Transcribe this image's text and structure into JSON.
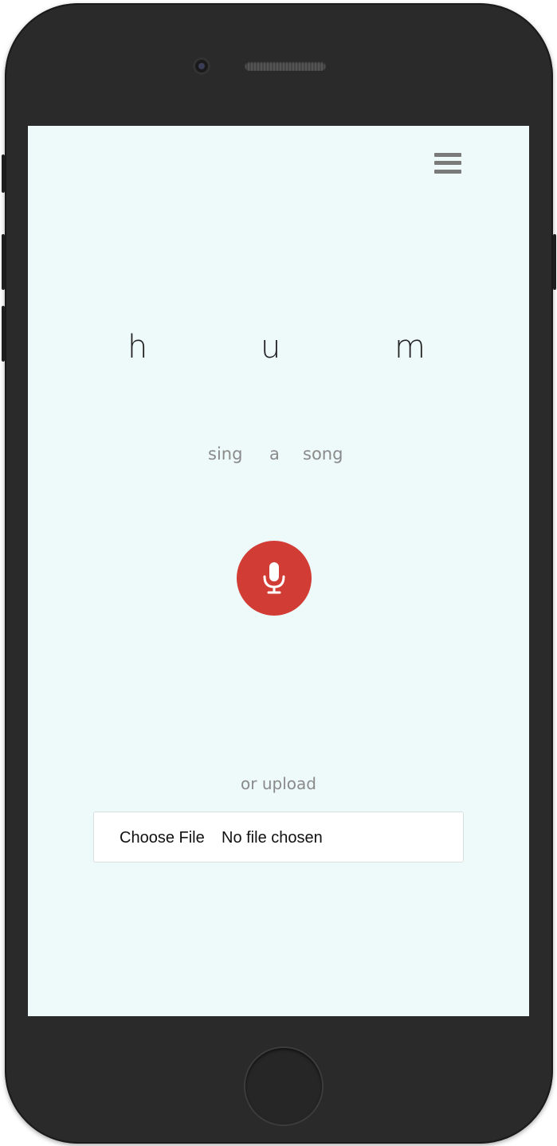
{
  "header": {
    "menu_icon": "hamburger-menu-icon"
  },
  "brand": {
    "letters": [
      "h",
      "u",
      "m"
    ]
  },
  "tagline": {
    "words": [
      "sing",
      "a",
      "song"
    ]
  },
  "record": {
    "icon": "microphone-icon",
    "color": "#d13c34"
  },
  "upload": {
    "label": "or upload",
    "button_label": "Choose File",
    "status": "No file chosen"
  },
  "colors": {
    "screen_background": "#eef9f9",
    "phone_body": "#2a2a2a"
  }
}
